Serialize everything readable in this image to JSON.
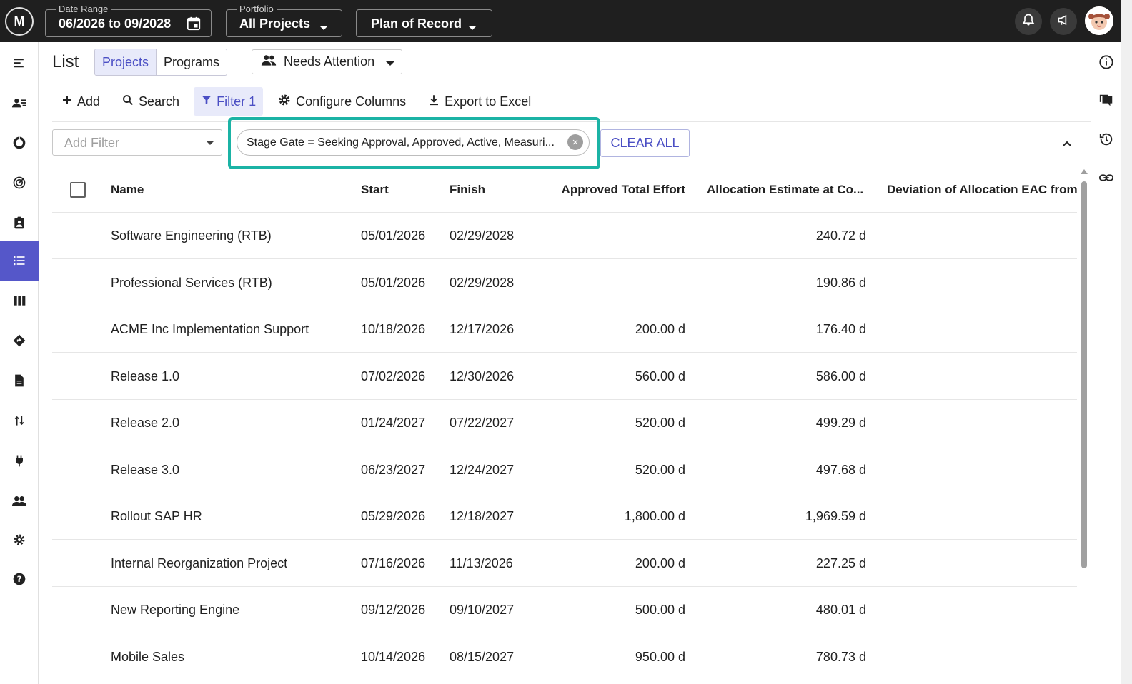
{
  "topbar": {
    "logo_text": "M",
    "date_range": {
      "label": "Date Range",
      "value": "06/2026 to 09/2028"
    },
    "portfolio": {
      "label": "Portfolio",
      "value": "All Projects"
    },
    "plan": {
      "value": "Plan of Record"
    }
  },
  "page": {
    "title": "List",
    "toggle": {
      "projects": "Projects",
      "programs": "Programs"
    },
    "view_select": "Needs Attention"
  },
  "toolbar": {
    "add": "Add",
    "search": "Search",
    "filter": "Filter 1",
    "configure": "Configure Columns",
    "export": "Export to Excel"
  },
  "filters": {
    "add_placeholder": "Add Filter",
    "chip": "Stage Gate = Seeking Approval, Approved, Active, Measuri...",
    "clear_all": "CLEAR ALL"
  },
  "table": {
    "columns": [
      "Name",
      "Start",
      "Finish",
      "Approved Total Effort",
      "Allocation Estimate at Co...",
      "Deviation of Allocation EAC from A"
    ],
    "rows": [
      {
        "name": "Software Engineering (RTB)",
        "start": "05/01/2026",
        "finish": "02/29/2028",
        "approved": "",
        "eac": "240.72 d"
      },
      {
        "name": "Professional Services (RTB)",
        "start": "05/01/2026",
        "finish": "02/29/2028",
        "approved": "",
        "eac": "190.86 d"
      },
      {
        "name": "ACME Inc Implementation Support",
        "start": "10/18/2026",
        "finish": "12/17/2026",
        "approved": "200.00 d",
        "eac": "176.40 d"
      },
      {
        "name": "Release 1.0",
        "start": "07/02/2026",
        "finish": "12/30/2026",
        "approved": "560.00 d",
        "eac": "586.00 d"
      },
      {
        "name": "Release 2.0",
        "start": "01/24/2027",
        "finish": "07/22/2027",
        "approved": "520.00 d",
        "eac": "499.29 d"
      },
      {
        "name": "Release 3.0",
        "start": "06/23/2027",
        "finish": "12/24/2027",
        "approved": "520.00 d",
        "eac": "497.68 d"
      },
      {
        "name": "Rollout SAP HR",
        "start": "05/29/2026",
        "finish": "12/18/2027",
        "approved": "1,800.00 d",
        "eac": "1,969.59 d"
      },
      {
        "name": "Internal Reorganization Project",
        "start": "07/16/2026",
        "finish": "11/13/2026",
        "approved": "200.00 d",
        "eac": "227.25 d"
      },
      {
        "name": "New Reporting Engine",
        "start": "09/12/2026",
        "finish": "09/10/2027",
        "approved": "500.00 d",
        "eac": "480.01 d"
      },
      {
        "name": "Mobile Sales",
        "start": "10/14/2026",
        "finish": "08/15/2027",
        "approved": "950.00 d",
        "eac": "780.73 d"
      }
    ]
  },
  "nav_icons": [
    "menu-icon",
    "resource-icon",
    "pie-chart-icon",
    "target-icon",
    "clipboard-icon",
    "list-icon",
    "board-icon",
    "roadmap-icon",
    "document-icon",
    "sort-icon",
    "plug-icon",
    "people-icon",
    "gear-icon",
    "help-icon"
  ],
  "colors": {
    "accent": "#5557c9",
    "highlight": "#1bb3a5",
    "topbar": "#1f1f1f"
  }
}
